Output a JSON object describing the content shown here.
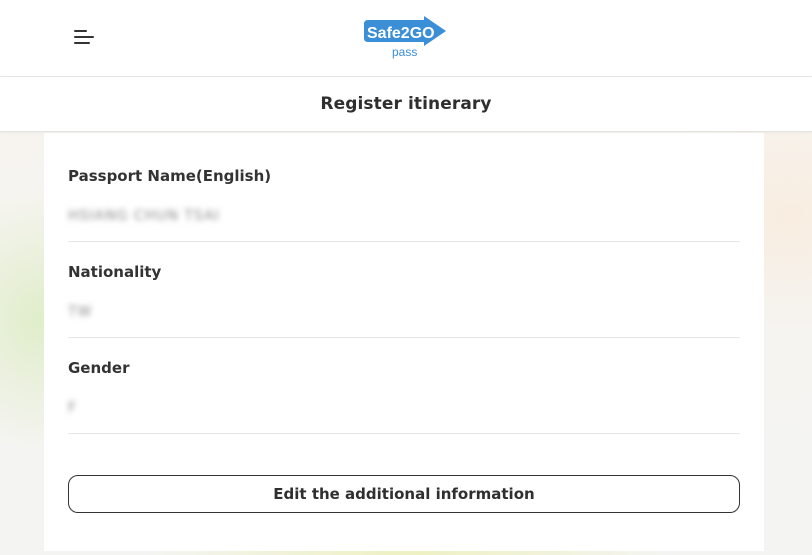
{
  "header": {
    "menu_icon": "hamburger-menu-icon",
    "logo": {
      "brand_text": "Safe2GO",
      "sub_text": "pass",
      "brand_color": "#3a8fd6"
    }
  },
  "page": {
    "title": "Register itinerary"
  },
  "profile": {
    "fields": [
      {
        "label": "Passport Name(English)",
        "value": "HSIANG CHUN    TSAI"
      },
      {
        "label": "Nationality",
        "value": "TW"
      },
      {
        "label": "Gender",
        "value": "F"
      }
    ]
  },
  "actions": {
    "edit_label": "Edit the additional information"
  }
}
